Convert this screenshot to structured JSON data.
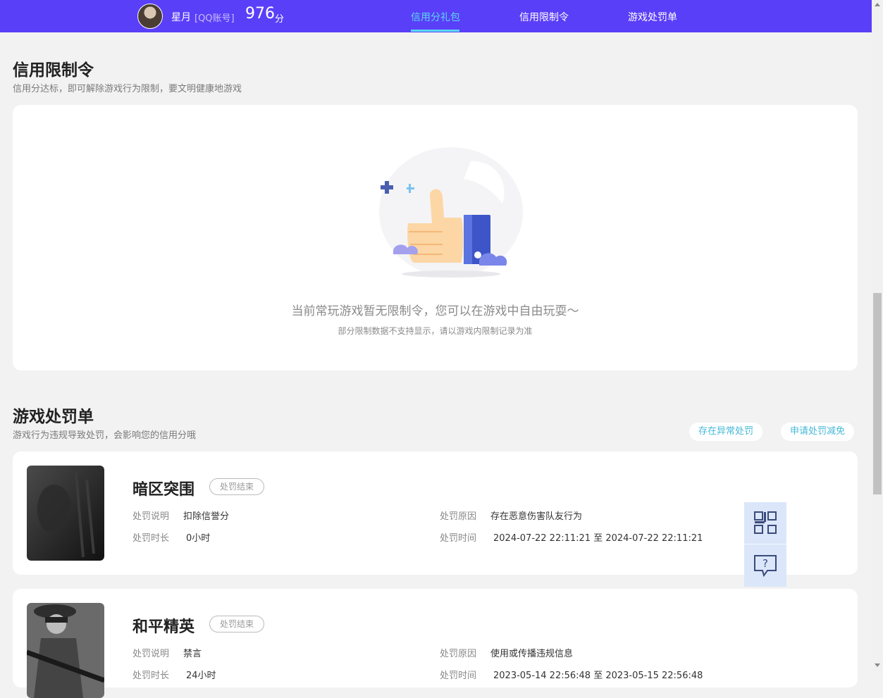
{
  "header": {
    "nickname": "星月",
    "account_type": "[QQ账号]",
    "score": "976",
    "score_unit": "分",
    "nav": [
      {
        "label": "信用分礼包",
        "active": true
      },
      {
        "label": "信用限制令",
        "active": false
      },
      {
        "label": "游戏处罚单",
        "active": false
      }
    ]
  },
  "restriction": {
    "title": "信用限制令",
    "subtitle": "信用分达标，即可解除游戏行为限制，要文明健康地游戏",
    "empty_text": "当前常玩游戏暂无限制令，您可以在游戏中自由玩耍～",
    "empty_note": "部分限制数据不支持显示，请以游戏内限制记录为准"
  },
  "penalty": {
    "title": "游戏处罚单",
    "subtitle": "游戏行为违规导致处罚，会影响您的信用分哦",
    "buttons": {
      "abnormal": "存在异常处罚",
      "apply_reduce": "申请处罚减免"
    },
    "labels": {
      "desc": "处罚说明",
      "reason": "处罚原因",
      "duration": "处罚时长",
      "time": "处罚时间"
    },
    "items": [
      {
        "game": "暗区突围",
        "status": "处罚结束",
        "desc": "扣除信誉分",
        "reason": "存在恶意伤害队友行为",
        "duration": "0小时",
        "time": "2024-07-22 22:11:21 至 2024-07-22 22:11:21"
      },
      {
        "game": "和平精英",
        "status": "处罚结束",
        "desc": "禁言",
        "reason": "使用或传播违规信息",
        "duration": "24小时",
        "time": "2023-05-14 22:56:48 至 2023-05-15 22:56:48"
      }
    ]
  },
  "colors": {
    "header_bg": "#5a3ff8",
    "accent": "#59d8f2",
    "pill_text": "#45b8d8"
  },
  "float_icons": [
    "qr-code-icon",
    "help-feedback-icon"
  ]
}
